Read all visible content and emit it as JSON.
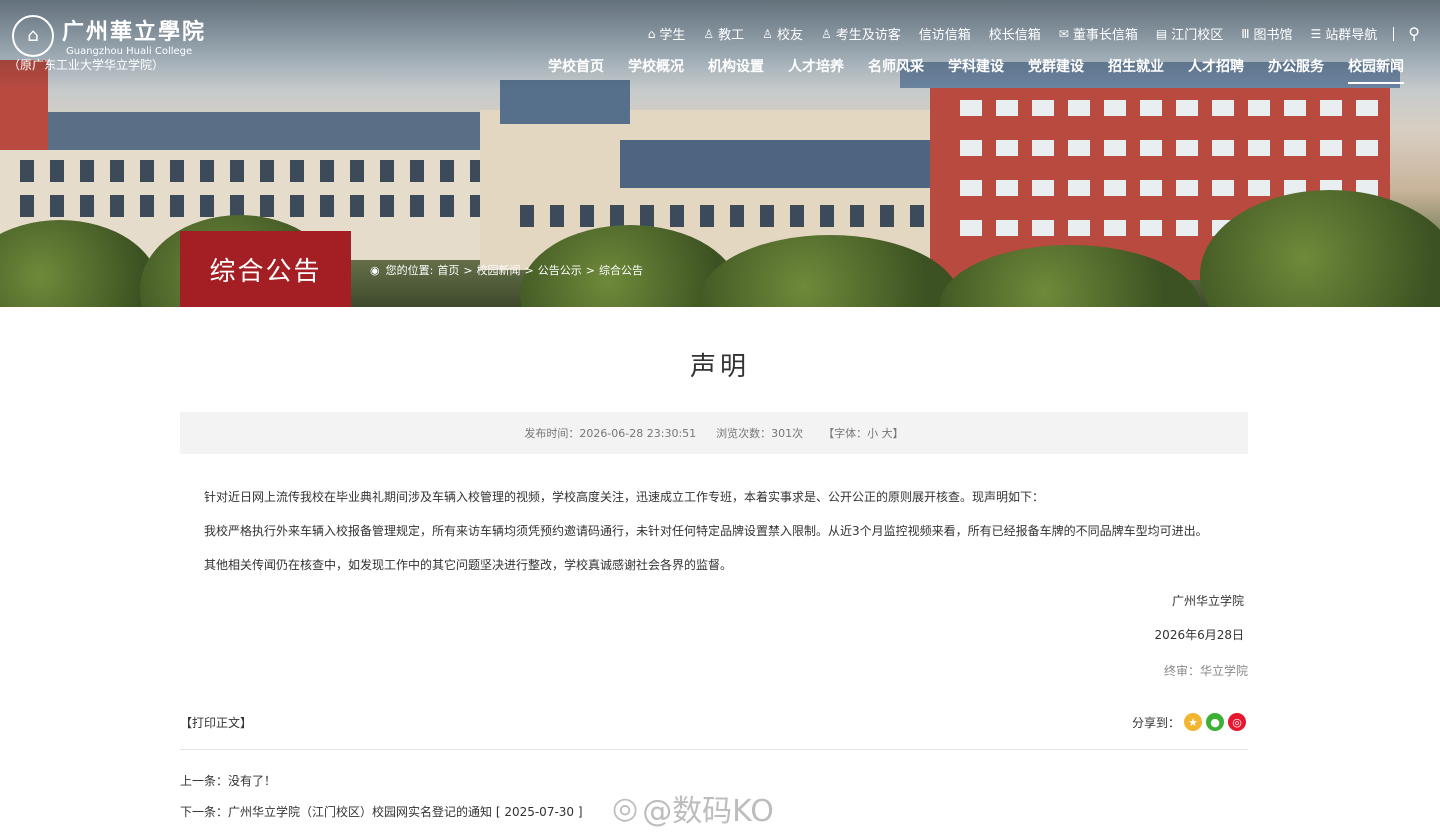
{
  "header": {
    "logo_cn": "广州華立學院",
    "logo_en": "Guangzhou Huali College",
    "logo_sub": "（原广东工业大学华立学院）",
    "utility_links": [
      {
        "label": "学生",
        "icon": "graduation-cap-icon",
        "glyph": "⌂"
      },
      {
        "label": "教工",
        "icon": "users-icon",
        "glyph": "♙"
      },
      {
        "label": "校友",
        "icon": "users-icon",
        "glyph": "♙"
      },
      {
        "label": "考生及访客",
        "icon": "user-icon",
        "glyph": "♙"
      },
      {
        "label": "信访信箱",
        "icon": "",
        "glyph": ""
      },
      {
        "label": "校长信箱",
        "icon": "",
        "glyph": ""
      },
      {
        "label": "董事长信箱",
        "icon": "mail-icon",
        "glyph": "✉"
      },
      {
        "label": "江门校区",
        "icon": "building-icon",
        "glyph": "▤"
      },
      {
        "label": "图书馆",
        "icon": "library-icon",
        "glyph": "Ⅲ"
      },
      {
        "label": "站群导航",
        "icon": "menu-icon",
        "glyph": "☰"
      }
    ],
    "nav_items": [
      "学校首页",
      "学校概况",
      "机构设置",
      "人才培养",
      "名师风采",
      "学科建设",
      "党群建设",
      "招生就业",
      "人才招聘",
      "办公服务",
      "校园新闻"
    ],
    "active_nav": "校园新闻"
  },
  "section_title": "综合公告",
  "breadcrumb": {
    "prefix": "您的位置:",
    "items": [
      "首页",
      "校园新闻",
      "公告公示",
      "综合公告"
    ],
    "separator": ">"
  },
  "article": {
    "title": "声明",
    "published": "发布时间：2026-06-28 23:30:51",
    "views": "浏览次数：301次",
    "font_size": "【字体：小 大】",
    "paragraphs": [
      "针对近日网上流传我校在毕业典礼期间涉及车辆入校管理的视频，学校高度关注，迅速成立工作专班，本着实事求是、公开公正的原则展开核查。现声明如下：",
      "我校严格执行外来车辆入校报备管理规定，所有来访车辆均须凭预约邀请码通行，未针对任何特定品牌设置禁入限制。从近3个月监控视频来看，所有已经报备车牌的不同品牌车型均可进出。",
      "其他相关传闻仍在核查中，如发现工作中的其它问题坚决进行整改，学校真诚感谢社会各界的监督。"
    ],
    "signature": "广州华立学院",
    "date": "2026年6月28日",
    "reviewer": "终审：华立学院"
  },
  "footer": {
    "print_label": "【打印正文】",
    "share_label": "分享到：",
    "prev": "上一条：没有了！",
    "next": "下一条：广州华立学院（江门校区）校园网实名登记的通知 [ 2025-07-30 ]"
  },
  "watermark": "@数码KO",
  "colors": {
    "accent": "#a41f24"
  }
}
